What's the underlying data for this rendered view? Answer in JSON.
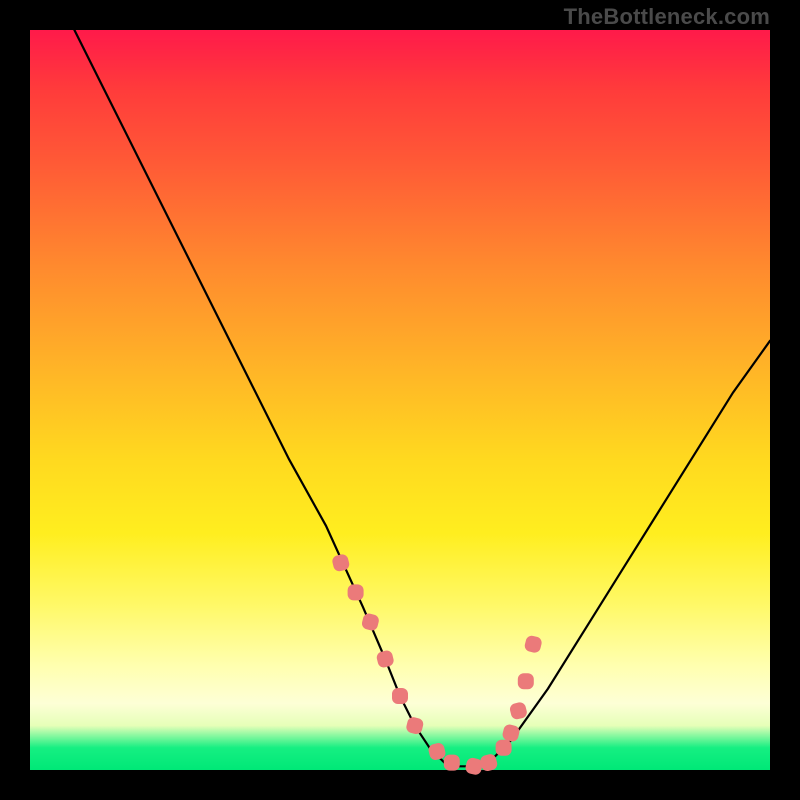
{
  "watermark": "TheBottleneck.com",
  "chart_data": {
    "type": "line",
    "title": "",
    "xlabel": "",
    "ylabel": "",
    "xlim": [
      0,
      100
    ],
    "ylim": [
      0,
      100
    ],
    "grid": false,
    "legend": false,
    "background_gradient": [
      "#ff1a4a",
      "#ff8a2e",
      "#ffd91f",
      "#ffffb0",
      "#00e877"
    ],
    "series": [
      {
        "name": "bottleneck-curve",
        "color": "#000000",
        "x": [
          6,
          10,
          15,
          20,
          25,
          30,
          35,
          40,
          45,
          48,
          50,
          52,
          54,
          56,
          58,
          60,
          62,
          65,
          70,
          75,
          80,
          85,
          90,
          95,
          100
        ],
        "y": [
          100,
          92,
          82,
          72,
          62,
          52,
          42,
          33,
          22,
          15,
          10,
          6,
          3,
          1,
          0.5,
          0.5,
          1,
          4,
          11,
          19,
          27,
          35,
          43,
          51,
          58
        ]
      },
      {
        "name": "highlighted-points",
        "color": "#eb7a7a",
        "type": "scatter",
        "marker": "rounded-square",
        "x": [
          42,
          44,
          46,
          48,
          50,
          52,
          55,
          57,
          60,
          62,
          64,
          65,
          66,
          67,
          68
        ],
        "y": [
          28,
          24,
          20,
          15,
          10,
          6,
          2.5,
          1,
          0.5,
          1,
          3,
          5,
          8,
          12,
          17
        ]
      }
    ]
  }
}
